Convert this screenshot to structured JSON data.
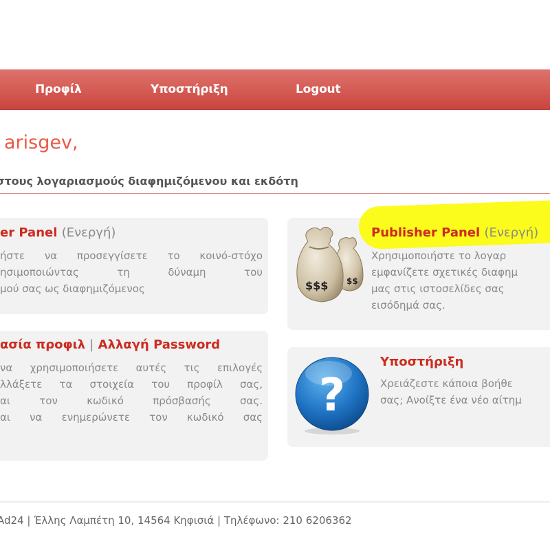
{
  "nav": {
    "items": [
      {
        "label": "Προφίλ"
      },
      {
        "label": "Υποστήριξη"
      },
      {
        "label": "Logout"
      }
    ]
  },
  "greeting": "arisgev,",
  "subtitle": "στους λογαριασμούς διαφημιζόμενου και εκδότη",
  "advertiser_card": {
    "title": "er Panel",
    "status": "(Ενεργή)",
    "lines": [
      "ήστε να προσεγγίσετε το κοινό-στόχο",
      "ησιμοποιώντας τη δύναμη του",
      "μού σας ως διαφημιζόμενος"
    ]
  },
  "publisher_card": {
    "icon_label": "$$$",
    "title": "Publisher Panel",
    "status": "(Ενεργή)",
    "lines": [
      "Χρησιμοποιήστε το λογαρ",
      "εμφανίζετε σχετικές διαφημ",
      "μας στις ιστοσελίδες σας",
      "εισόδημά σας."
    ]
  },
  "profile_card": {
    "link1": "ασία προφιλ",
    "separator": "|",
    "link2": "Αλλαγή Password",
    "lines": [
      "να χρησιμοποιήσετε αυτές τις επιλογές",
      "λλάξετε τα στοιχεία του προφίλ σας,",
      "αι τον κωδικό πρόσβασής σας.",
      "αι να ενημερώνετε τον κωδικό σας"
    ]
  },
  "support_card": {
    "icon_label": "?",
    "title": "Υποστήριξη",
    "lines": [
      "Χρειάζεστε κάποια βοήθε",
      "σας; Ανοίξτε ένα νέο αίτημ"
    ]
  },
  "footer": "Ad24 | Έλλης Λαμπέτη 10, 14564 Κηφισιά | Τηλέφωνο: 210 6206362",
  "colors": {
    "nav": "#d65f58",
    "accent": "#cc2b1f",
    "greeting": "#e85a45",
    "highlight": "#fbfb1c",
    "card_bg": "#f2f2f2"
  }
}
